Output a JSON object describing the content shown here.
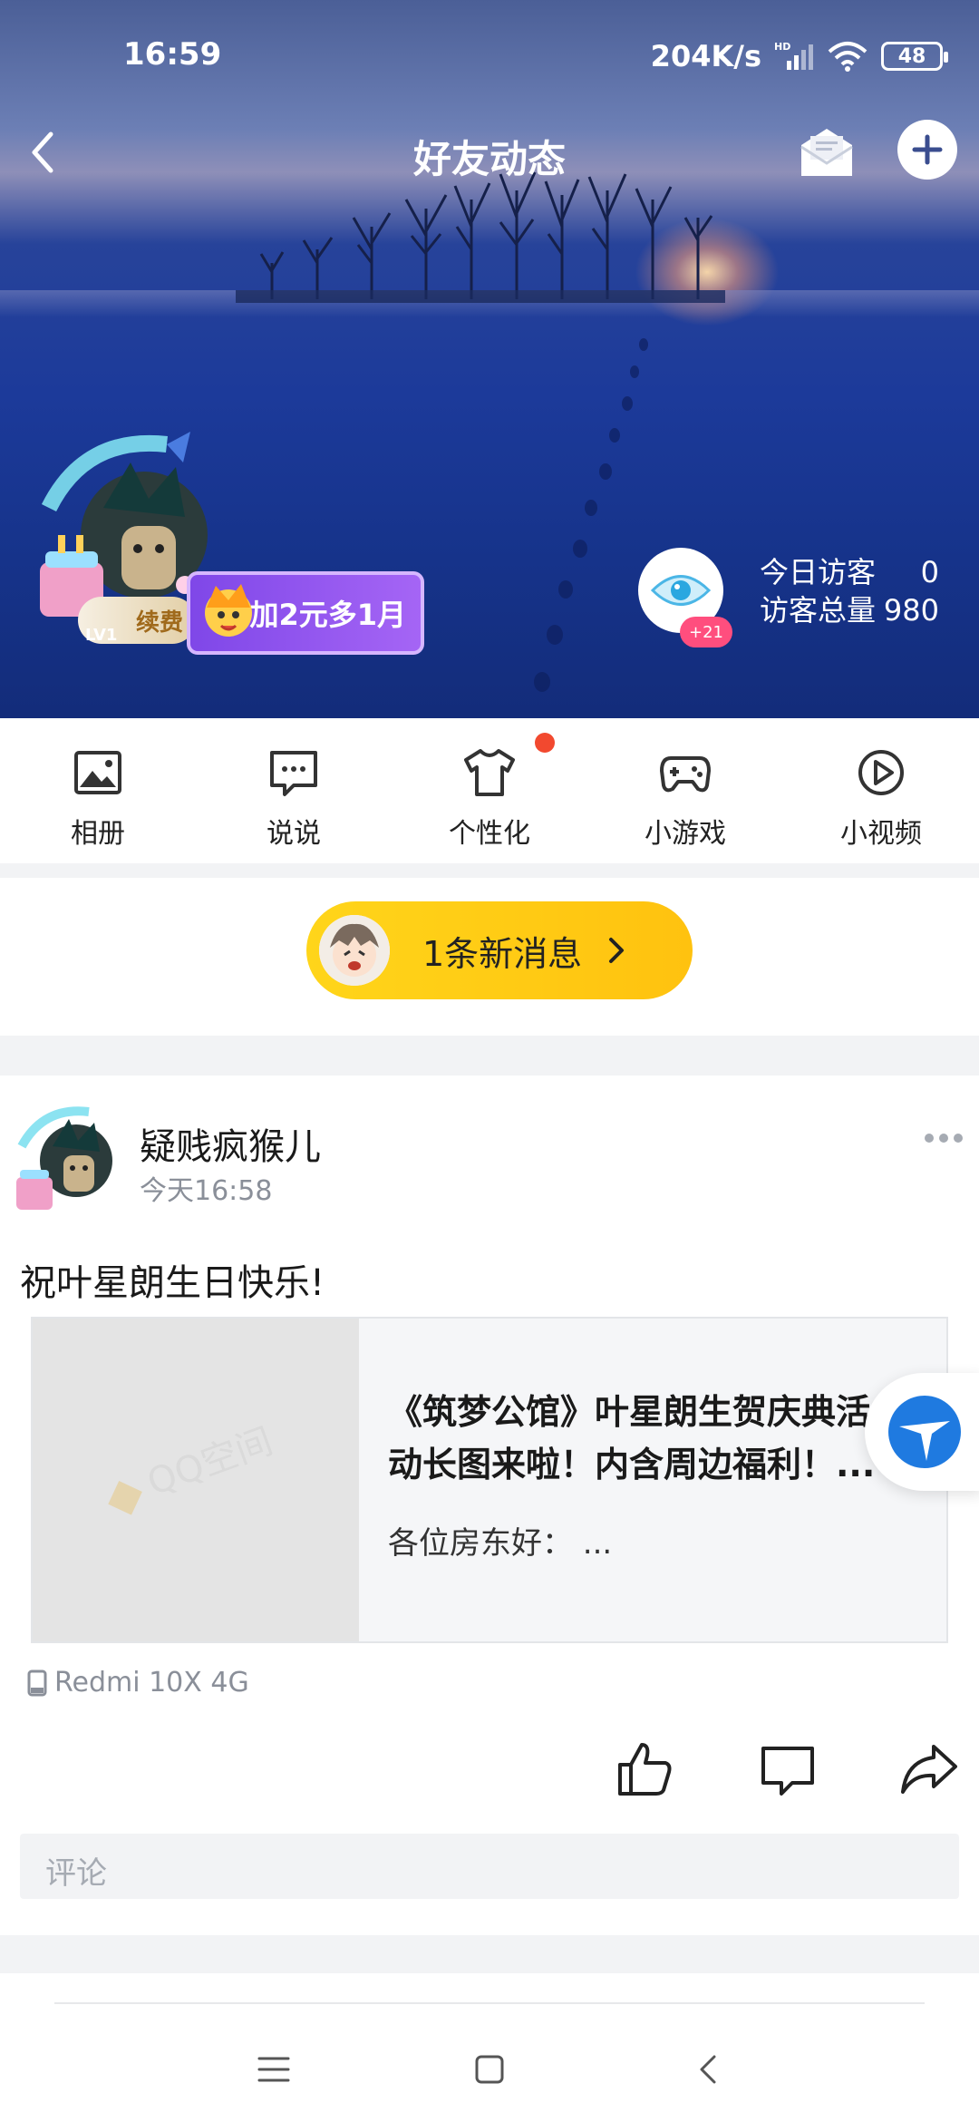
{
  "status_bar": {
    "time": "16:59",
    "network_speed": "204K/s",
    "network_tag": "HD",
    "battery": "48"
  },
  "nav": {
    "title": "好友动态"
  },
  "profile": {
    "renew_label": "续费",
    "level": "LV1",
    "promo_label": "加2元多1月",
    "visitor_badge": "+21",
    "today_visitors_label": "今日访客",
    "today_visitors_value": "0",
    "total_visitors_label": "访客总量",
    "total_visitors_value": "980"
  },
  "features": [
    {
      "label": "相册",
      "icon": "photo-album-icon"
    },
    {
      "label": "说说",
      "icon": "chat-bubble-icon"
    },
    {
      "label": "个性化",
      "icon": "tshirt-icon"
    },
    {
      "label": "小游戏",
      "icon": "gamepad-icon"
    },
    {
      "label": "小视频",
      "icon": "play-circle-icon"
    }
  ],
  "new_messages": {
    "label": "1条新消息"
  },
  "post": {
    "author": "疑贱疯猴儿",
    "time": "今天16:58",
    "text": "祝叶星朗生日快乐!",
    "link_title": "《筑梦公馆》叶星朗生贺庆典活\n动长图来啦！内含周边福利！...",
    "link_desc": "各位房东好：  ...",
    "thumb_watermark": "QQ空间",
    "device": "Redmi 10X 4G",
    "comment_placeholder": "评论"
  },
  "colors": {
    "accent_yellow": "#ffc20f",
    "promo_purple": "#8b52ee",
    "badge_pink": "#ff4e7e",
    "red_dot": "#f2492f"
  }
}
